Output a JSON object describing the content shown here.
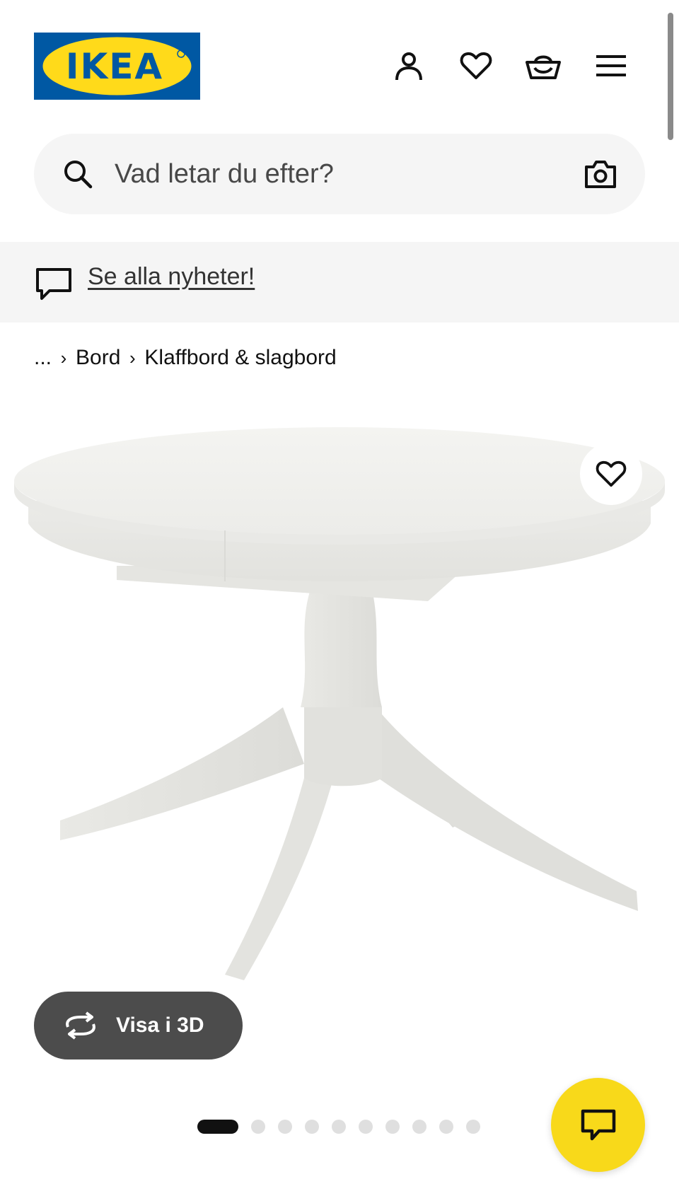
{
  "header": {
    "logo_text": "IKEA",
    "logo_colors": {
      "blue": "#0058a3",
      "yellow": "#ffda1a"
    },
    "icons": [
      "person-icon",
      "heart-icon",
      "basket-icon",
      "hamburger-menu-icon"
    ]
  },
  "search": {
    "placeholder": "Vad letar du efter?",
    "icons": [
      "search-icon",
      "camera-icon"
    ]
  },
  "news_banner": {
    "link_text": "Se alla nyheter!",
    "icon": "speech-bubble-icon"
  },
  "breadcrumb": {
    "ellipsis": "...",
    "items": [
      "Bord",
      "Klaffbord & slagbord"
    ]
  },
  "product_gallery": {
    "view_3d_label": "Visa i 3D",
    "slide_count": 10,
    "active_slide": 1,
    "favorite_icon": "heart-icon"
  },
  "chat": {
    "icon": "chat-bubble-icon",
    "color": "#f8d91a"
  }
}
